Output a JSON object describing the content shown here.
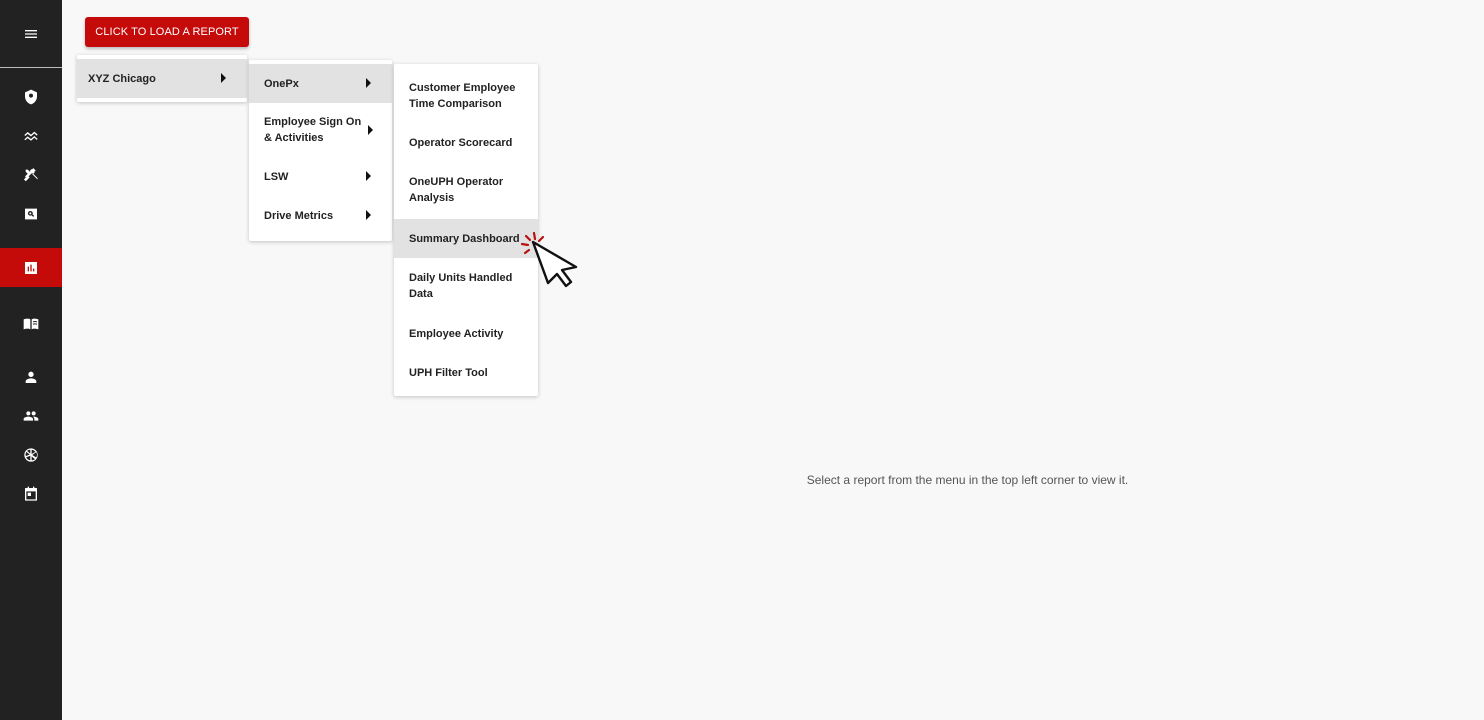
{
  "sidebar": {
    "menu_icon": "hamburger-icon",
    "items": [
      {
        "icon": "shield-icon"
      },
      {
        "icon": "trend-icon"
      },
      {
        "icon": "tools-icon"
      },
      {
        "icon": "search-report-icon"
      },
      {
        "icon": "bar-chart-icon",
        "active": true
      },
      {
        "icon": "book-icon"
      },
      {
        "icon": "person-icon"
      },
      {
        "icon": "group-icon"
      },
      {
        "icon": "aperture-icon"
      },
      {
        "icon": "calendar-icon"
      }
    ],
    "active_color": "#c50a0a",
    "background": "#222222"
  },
  "toolbar": {
    "load_report_label": "CLICK TO LOAD A REPORT"
  },
  "menu_level1": {
    "items": [
      {
        "label": "XYZ Chicago",
        "has_submenu": true,
        "highlighted": true
      }
    ]
  },
  "menu_level2": {
    "items": [
      {
        "label": "OnePx",
        "has_submenu": true,
        "highlighted": true
      },
      {
        "label": "Employee Sign On & Activities",
        "has_submenu": true
      },
      {
        "label": "LSW",
        "has_submenu": true
      },
      {
        "label": "Drive Metrics",
        "has_submenu": true
      }
    ]
  },
  "menu_level3": {
    "items": [
      {
        "label": "Customer Employee Time Comparison"
      },
      {
        "label": "Operator Scorecard"
      },
      {
        "label": "OneUPH Operator Analysis"
      },
      {
        "label": "Summary Dashboard",
        "highlighted": true
      },
      {
        "label": "Daily Units Handled Data"
      },
      {
        "label": "Employee Activity"
      },
      {
        "label": "UPH Filter Tool"
      }
    ]
  },
  "main": {
    "empty_message": "Select a report from the menu in the top left corner to view it."
  },
  "colors": {
    "accent": "#c50a0a",
    "menu_highlight": "#e2e2e2",
    "page_background": "#f8f8f8"
  }
}
